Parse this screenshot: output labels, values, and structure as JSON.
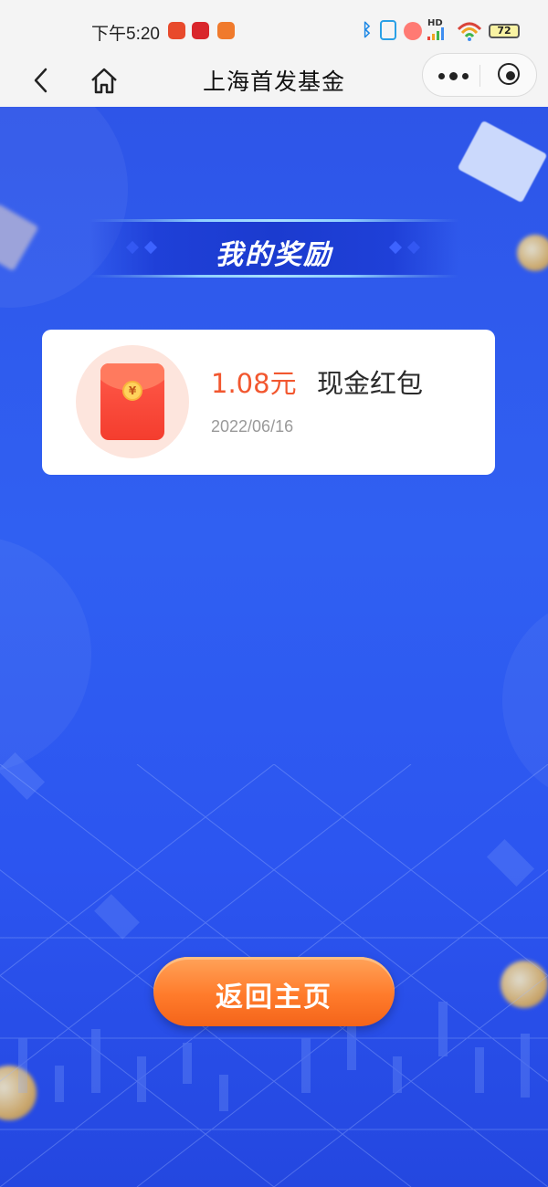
{
  "status_bar": {
    "time": "下午5:20",
    "battery": "72",
    "hd_label": "HD"
  },
  "nav_bar": {
    "title": "上海首发基金",
    "icons": [
      "back-arrow-icon",
      "home-icon",
      "more-icon",
      "target-icon"
    ]
  },
  "banner": {
    "title": "我的奖励"
  },
  "reward": {
    "amount": "1.08元",
    "name": "现金红包",
    "date": "2022/06/16",
    "packet_symbol": "¥",
    "amount_color": "#f2572f"
  },
  "actions": {
    "return_home": "返回主页"
  },
  "colors": {
    "background": "#2f5af0",
    "button": "#ff7b2b"
  }
}
